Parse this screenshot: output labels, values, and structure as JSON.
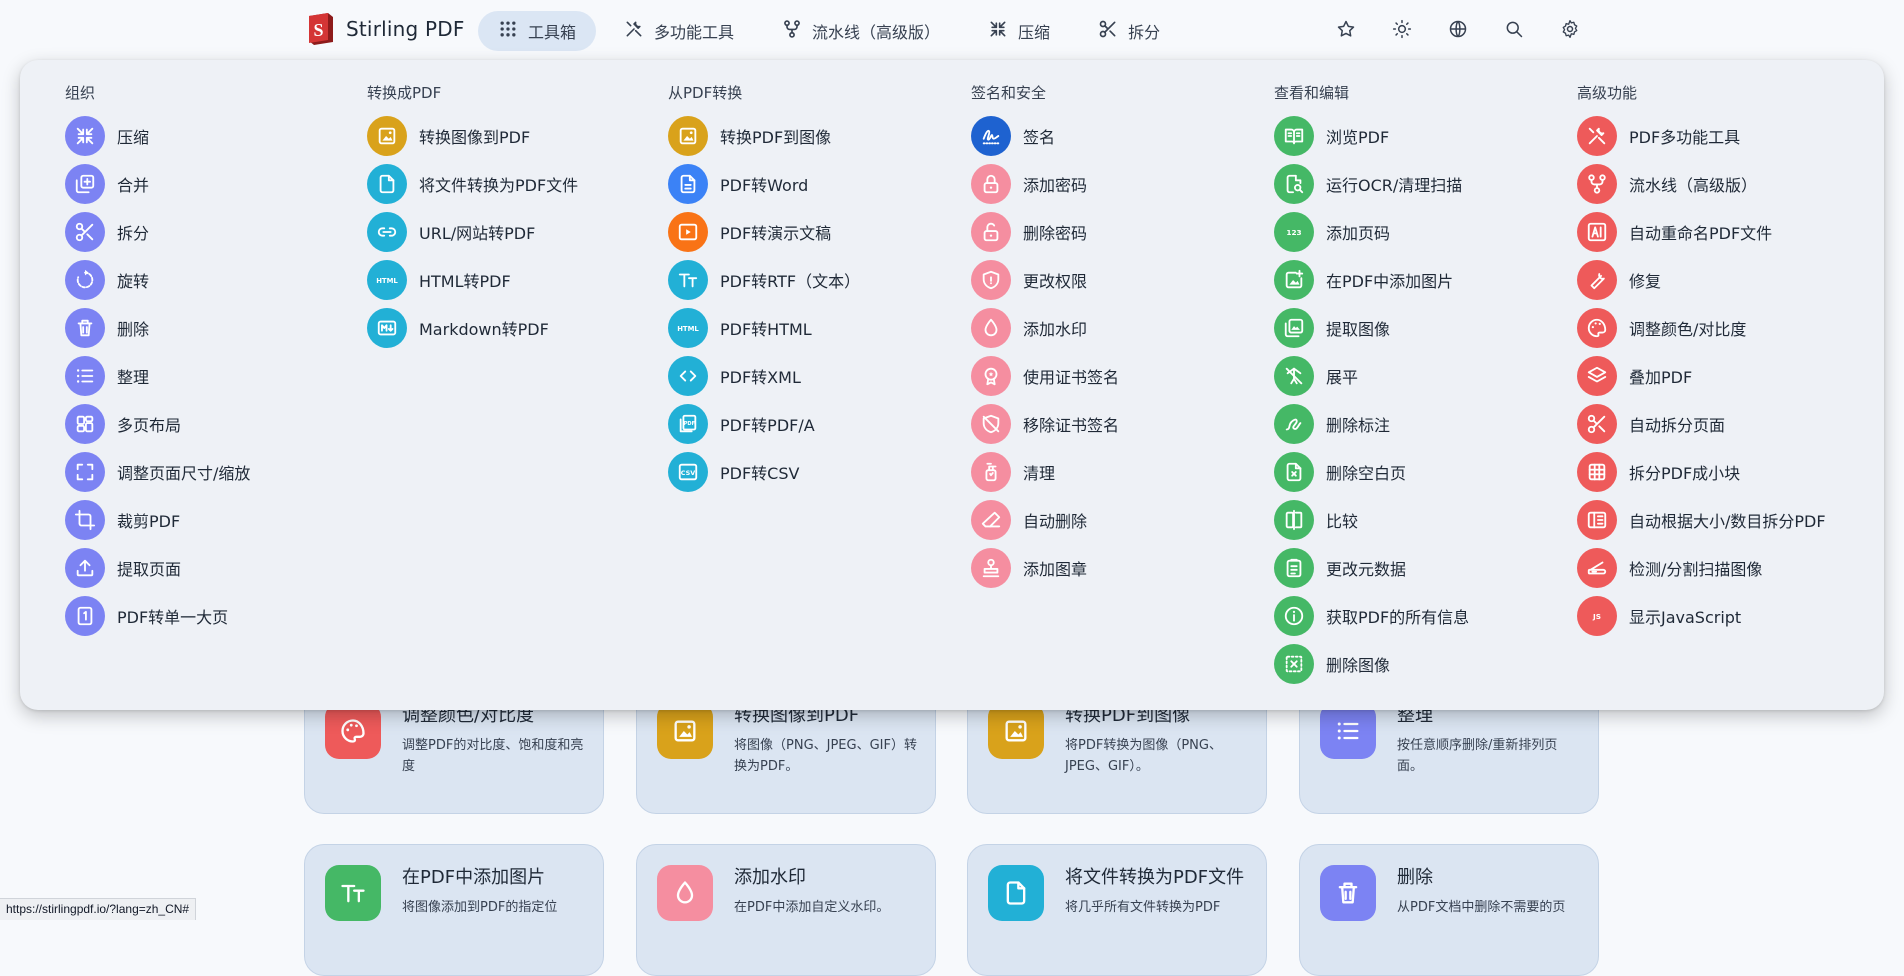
{
  "app": {
    "name": "Stirling PDF"
  },
  "nav": {
    "items": [
      {
        "label": "工具箱",
        "icon": "grid-icon"
      },
      {
        "label": "多功能工具",
        "icon": "tools-icon"
      },
      {
        "label": "流水线（高级版）",
        "icon": "pipeline-icon"
      },
      {
        "label": "压缩",
        "icon": "compress-icon"
      },
      {
        "label": "拆分",
        "icon": "scissors-icon"
      }
    ],
    "icons": [
      "star-icon",
      "sun-icon",
      "globe-icon",
      "search-icon",
      "gear-icon"
    ]
  },
  "colors": {
    "organize": "#7c83f3",
    "convert": "#f0b90b",
    "convert_to": "#d9a21b",
    "convert_from": "#22b0d6",
    "security": "#f58ea0",
    "view": "#45b866",
    "advanced": "#ee5a5a"
  },
  "menu": {
    "columns": [
      {
        "title": "组织",
        "color": "#7c83f3",
        "items": [
          {
            "label": "压缩",
            "icon": "compress-icon"
          },
          {
            "label": "合并",
            "icon": "merge-icon"
          },
          {
            "label": "拆分",
            "icon": "scissors-icon"
          },
          {
            "label": "旋转",
            "icon": "rotate-icon"
          },
          {
            "label": "删除",
            "icon": "trash-icon"
          },
          {
            "label": "整理",
            "icon": "list-icon"
          },
          {
            "label": "多页布局",
            "icon": "layout-icon"
          },
          {
            "label": "调整页面尺寸/缩放",
            "icon": "fullscreen-icon"
          },
          {
            "label": "裁剪PDF",
            "icon": "crop-icon"
          },
          {
            "label": "提取页面",
            "icon": "upload-icon"
          },
          {
            "label": "PDF转单一大页",
            "icon": "single-page-icon"
          }
        ]
      },
      {
        "title": "转换成PDF",
        "color": "#d9a21b",
        "items": [
          {
            "label": "转换图像到PDF",
            "icon": "image-icon",
            "color": "#d9a21b"
          },
          {
            "label": "将文件转换为PDF文件",
            "icon": "file-icon",
            "color": "#22b0d6"
          },
          {
            "label": "URL/网站转PDF",
            "icon": "link-icon",
            "color": "#22b0d6"
          },
          {
            "label": "HTML转PDF",
            "icon": "html-icon",
            "color": "#22b0d6"
          },
          {
            "label": "Markdown转PDF",
            "icon": "markdown-icon",
            "color": "#22b0d6"
          }
        ]
      },
      {
        "title": "从PDF转换",
        "color": "#22b0d6",
        "items": [
          {
            "label": "转换PDF到图像",
            "icon": "image-icon",
            "color": "#d9a21b"
          },
          {
            "label": "PDF转Word",
            "icon": "doc-icon",
            "color": "#3b82f6"
          },
          {
            "label": "PDF转演示文稿",
            "icon": "slides-icon",
            "color": "#f97316"
          },
          {
            "label": "PDF转RTF（文本）",
            "icon": "text-icon",
            "color": "#22b0d6"
          },
          {
            "label": "PDF转HTML",
            "icon": "html-icon",
            "color": "#22b0d6"
          },
          {
            "label": "PDF转XML",
            "icon": "code-icon",
            "color": "#22b0d6"
          },
          {
            "label": "PDF转PDF/A",
            "icon": "pdfa-icon",
            "color": "#22b0d6"
          },
          {
            "label": "PDF转CSV",
            "icon": "csv-icon",
            "color": "#22b0d6"
          }
        ]
      },
      {
        "title": "签名和安全",
        "color": "#f58ea0",
        "items": [
          {
            "label": "签名",
            "icon": "signature-icon",
            "color": "#1e62d0"
          },
          {
            "label": "添加密码",
            "icon": "lock-icon"
          },
          {
            "label": "删除密码",
            "icon": "unlock-icon"
          },
          {
            "label": "更改权限",
            "icon": "shield-icon"
          },
          {
            "label": "添加水印",
            "icon": "drop-icon"
          },
          {
            "label": "使用证书签名",
            "icon": "certificate-icon"
          },
          {
            "label": "移除证书签名",
            "icon": "shield-off-icon"
          },
          {
            "label": "清理",
            "icon": "sanitize-icon"
          },
          {
            "label": "自动删除",
            "icon": "eraser-icon"
          },
          {
            "label": "添加图章",
            "icon": "stamp-icon"
          }
        ]
      },
      {
        "title": "查看和编辑",
        "color": "#45b866",
        "items": [
          {
            "label": "浏览PDF",
            "icon": "book-icon"
          },
          {
            "label": "运行OCR/清理扫描",
            "icon": "ocr-icon"
          },
          {
            "label": "添加页码",
            "icon": "number-icon"
          },
          {
            "label": "在PDF中添加图片",
            "icon": "add-image-icon"
          },
          {
            "label": "提取图像",
            "icon": "extract-image-icon"
          },
          {
            "label": "展平",
            "icon": "flatten-icon"
          },
          {
            "label": "删除标注",
            "icon": "scribble-icon"
          },
          {
            "label": "删除空白页",
            "icon": "blank-page-icon"
          },
          {
            "label": "比较",
            "icon": "compare-icon"
          },
          {
            "label": "更改元数据",
            "icon": "clipboard-icon"
          },
          {
            "label": "获取PDF的所有信息",
            "icon": "info-icon"
          },
          {
            "label": "删除图像",
            "icon": "remove-image-icon"
          }
        ]
      },
      {
        "title": "高级功能",
        "color": "#ee5a5a",
        "items": [
          {
            "label": "PDF多功能工具",
            "icon": "tools-icon"
          },
          {
            "label": "流水线（高级版）",
            "icon": "pipeline-icon"
          },
          {
            "label": "自动重命名PDF文件",
            "icon": "ai-icon"
          },
          {
            "label": "修复",
            "icon": "wrench-icon"
          },
          {
            "label": "调整颜色/对比度",
            "icon": "palette-icon"
          },
          {
            "label": "叠加PDF",
            "icon": "layers-icon"
          },
          {
            "label": "自动拆分页面",
            "icon": "scissors-icon"
          },
          {
            "label": "拆分PDF成小块",
            "icon": "table-icon"
          },
          {
            "label": "自动根据大小/数目拆分PDF",
            "icon": "split-size-icon"
          },
          {
            "label": "检测/分割扫描图像",
            "icon": "scanner-icon"
          },
          {
            "label": "显示JavaScript",
            "icon": "js-icon"
          }
        ]
      }
    ]
  },
  "cards": [
    {
      "title": "调整颜色/对比度",
      "desc": "调整PDF的对比度、饱和度和亮度",
      "icon": "palette-icon",
      "color": "#ee5a5a"
    },
    {
      "title": "转换图像到PDF",
      "desc": "将图像（PNG、JPEG、GIF）转换为PDF。",
      "icon": "image-icon",
      "color": "#d9a21b"
    },
    {
      "title": "转换PDF到图像",
      "desc": "将PDF转换为图像（PNG、JPEG、GIF）。",
      "icon": "image-icon",
      "color": "#d9a21b"
    },
    {
      "title": "整理",
      "desc": "按任意顺序删除/重新排列页面。",
      "icon": "list-icon",
      "color": "#7c83f3"
    },
    {
      "title": "在PDF中添加图片",
      "desc": "将图像添加到PDF的指定位",
      "icon": "text-icon",
      "color": "#45b866"
    },
    {
      "title": "添加水印",
      "desc": "在PDF中添加自定义水印。",
      "icon": "drop-icon",
      "color": "#f58ea0"
    },
    {
      "title": "将文件转换为PDF文件",
      "desc": "将几乎所有文件转换为PDF",
      "icon": "file-icon",
      "color": "#22b0d6"
    },
    {
      "title": "删除",
      "desc": "从PDF文档中删除不需要的页",
      "icon": "trash-icon",
      "color": "#7c83f3"
    }
  ],
  "status": {
    "url": "https://stirlingpdf.io/?lang=zh_CN#"
  }
}
